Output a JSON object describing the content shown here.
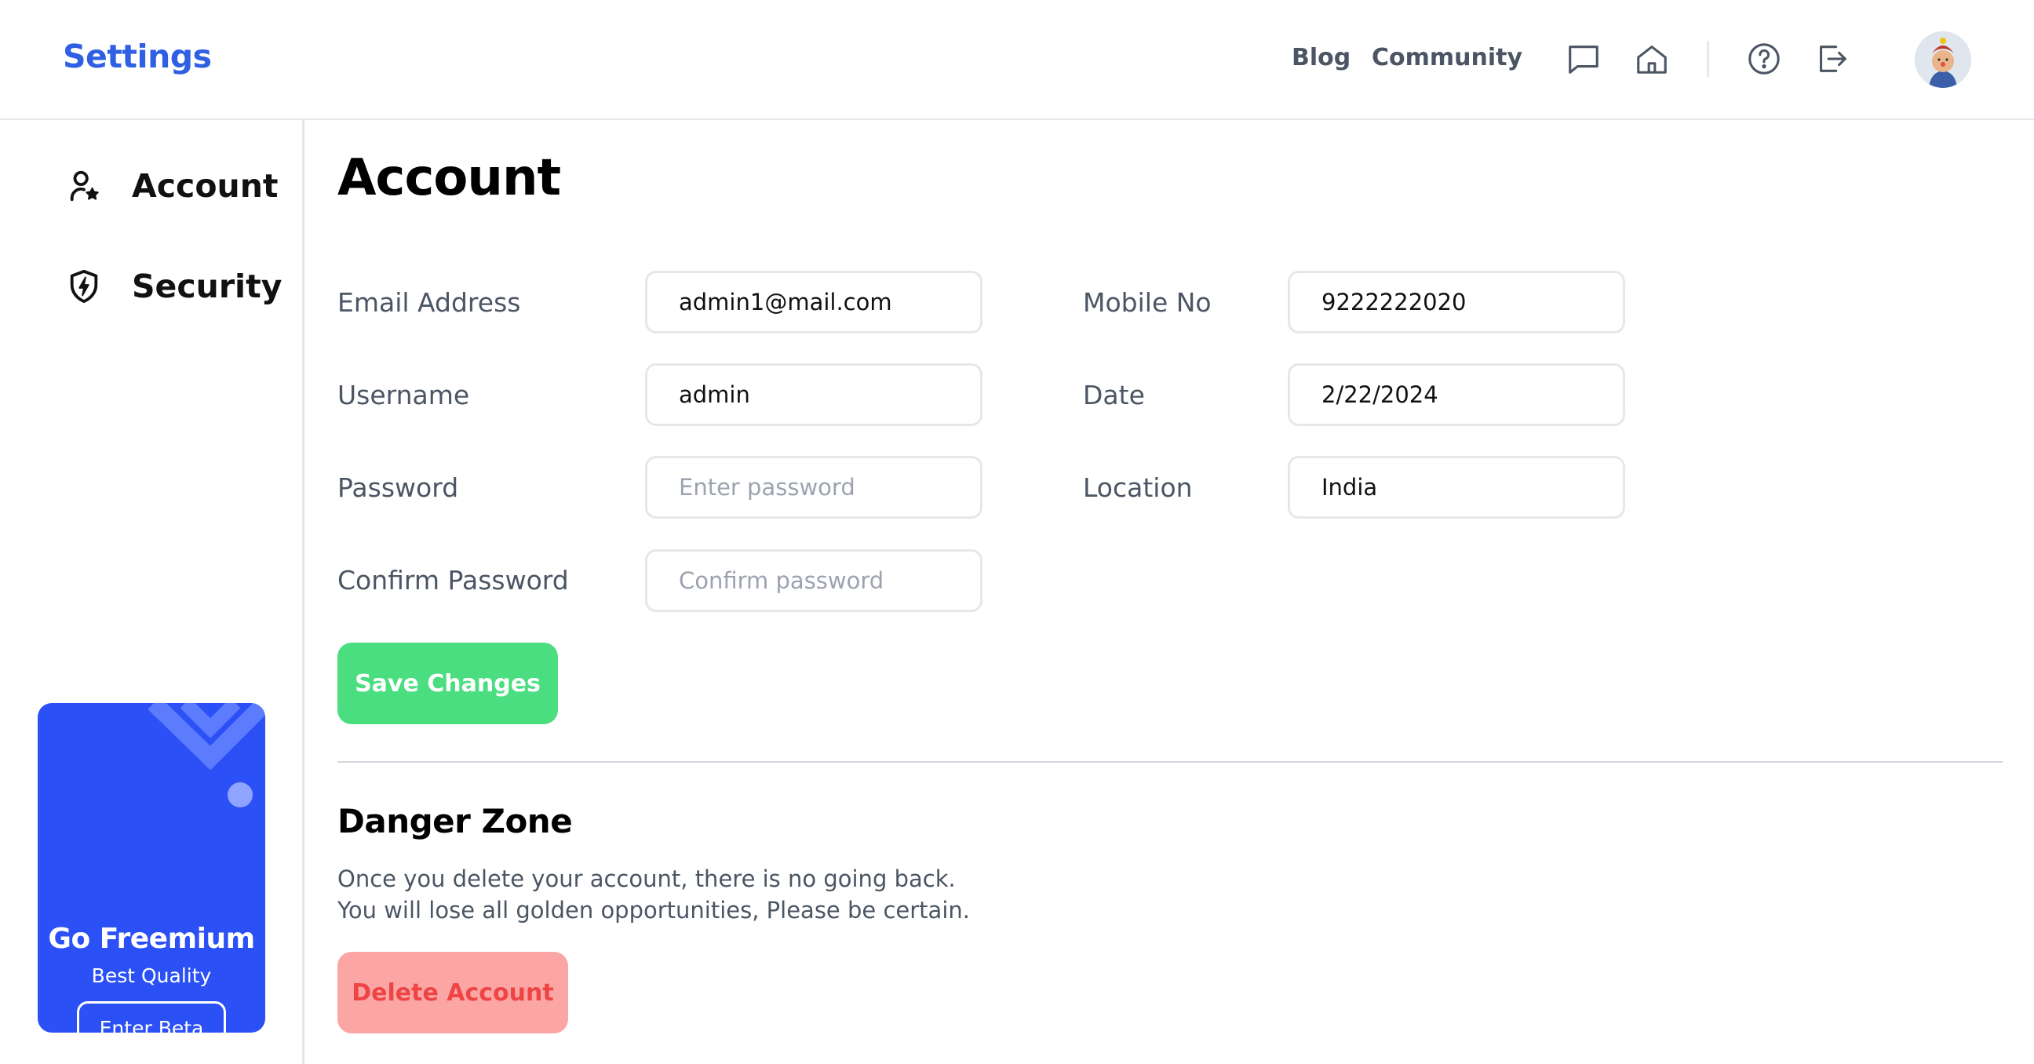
{
  "header": {
    "brand": "Settings",
    "nav": {
      "blog": "Blog",
      "community": "Community"
    },
    "icons": [
      "message-icon",
      "home-icon",
      "help-icon",
      "logout-icon"
    ]
  },
  "sidebar": {
    "items": [
      {
        "label": "Account",
        "icon": "user-star-icon"
      },
      {
        "label": "Security",
        "icon": "shield-bolt-icon"
      }
    ],
    "promo": {
      "title": "Go Freemium",
      "subtitle": "Best Quality",
      "button": "Enter Beta"
    }
  },
  "main": {
    "title": "Account",
    "fields": {
      "email": {
        "label": "Email Address",
        "value": "admin1@mail.com",
        "placeholder": ""
      },
      "username": {
        "label": "Username",
        "value": "admin",
        "placeholder": ""
      },
      "password": {
        "label": "Password",
        "value": "",
        "placeholder": "Enter password"
      },
      "confirm": {
        "label": "Confirm Password",
        "value": "",
        "placeholder": "Confirm password"
      },
      "mobile": {
        "label": "Mobile No",
        "value": "9222222020",
        "placeholder": ""
      },
      "date": {
        "label": "Date",
        "value": "2/22/2024",
        "placeholder": ""
      },
      "location": {
        "label": "Location",
        "value": "India",
        "placeholder": ""
      }
    },
    "save_label": "Save Changes",
    "danger": {
      "title": "Danger Zone",
      "text": "Once you delete your account, there is no going back. You will lose all golden opportunities, Please be certain.",
      "delete_label": "Delete Account"
    }
  },
  "colors": {
    "brand": "#2f5fe3",
    "save": "#4ade80",
    "delete_bg": "#fca5a5",
    "delete_text": "#ef4444",
    "promo": "#2b50f5"
  }
}
